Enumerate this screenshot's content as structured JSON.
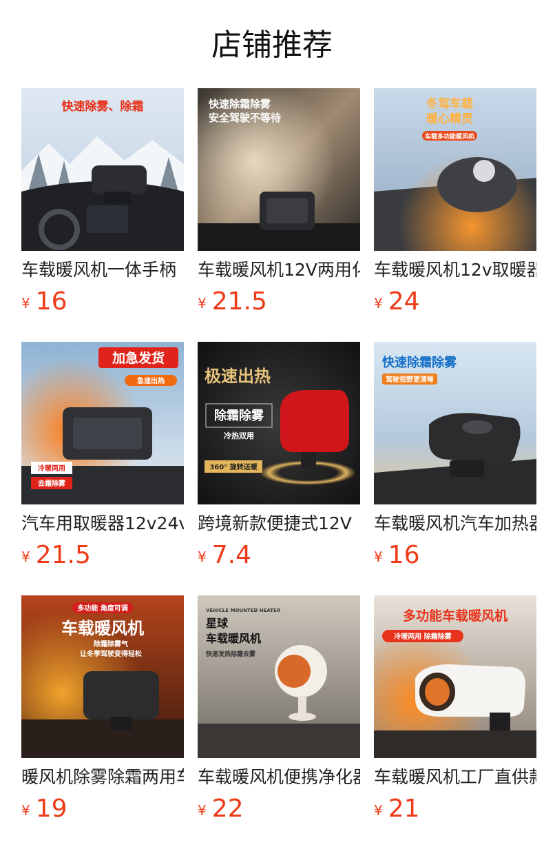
{
  "section": {
    "title": "店铺推荐"
  },
  "products": [
    {
      "name": "车载暖风机一体手柄",
      "currency": "¥",
      "price": "16",
      "banner": {
        "line1": "快速除雾、除霜",
        "line2": ""
      }
    },
    {
      "name": "车载暖风机12V两用化",
      "currency": "¥",
      "price": "21.5",
      "banner": {
        "line1": "快速除霜除雾",
        "line2": "安全驾驶不等待"
      }
    },
    {
      "name": "车载暖风机12v取暖器",
      "currency": "¥",
      "price": "24",
      "banner": {
        "line1": "冬驾车载",
        "line2": "暖心精灵",
        "tag": "车载多功能暖风机"
      }
    },
    {
      "name": "汽车用取暖器12v24v",
      "currency": "¥",
      "price": "21.5",
      "banner": {
        "line1": "加急发货",
        "tag": "急速出热",
        "badge1": "冷暖两用",
        "badge2": "去霜除雾"
      }
    },
    {
      "name": "跨境新款便捷式12V",
      "currency": "¥",
      "price": "7.4",
      "banner": {
        "line1": "极速出热",
        "line2": "除霜除雾",
        "line3": "冷热双用",
        "badge1": "360° 旋转送暖"
      }
    },
    {
      "name": "车载暖风机汽车加热器",
      "currency": "¥",
      "price": "16",
      "banner": {
        "line1": "快速除霜除雾",
        "tag": "驾驶视野更清晰"
      }
    },
    {
      "name": "暖风机除雾除霜两用车",
      "currency": "¥",
      "price": "19",
      "banner": {
        "line1": "车载暖风机",
        "tag": "多功能 角度可调",
        "line2": "除霜除雾气",
        "line3": "让冬季驾驶变得轻松"
      }
    },
    {
      "name": "车载暖风机便携净化器",
      "currency": "¥",
      "price": "22",
      "banner": {
        "eyebrow": "VEHICLE MOUNTED HEATER",
        "line1": "星球",
        "line2": "车载暖风机",
        "line3": "快速发热除霜去雾"
      }
    },
    {
      "name": "车载暖风机工厂直供款",
      "currency": "¥",
      "price": "21",
      "banner": {
        "line1": "多功能车载暖风机",
        "tag": "冷暖两用 除霜除雾"
      }
    }
  ]
}
